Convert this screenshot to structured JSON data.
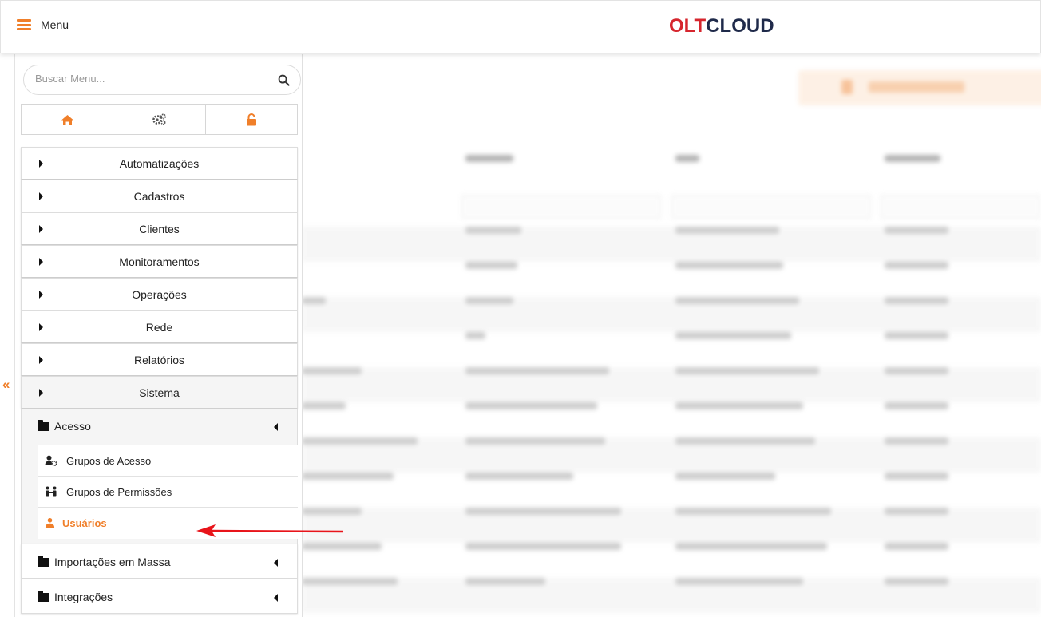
{
  "topbar": {
    "menu_label": "Menu",
    "logo_part1": "OLT",
    "logo_part2": "CLOUD"
  },
  "sidebar": {
    "search": {
      "placeholder": "Buscar Menu...",
      "value": ""
    },
    "quick_buttons": [
      {
        "icon": "home-icon"
      },
      {
        "icon": "gears-icon"
      },
      {
        "icon": "unlock-icon"
      }
    ],
    "items": [
      {
        "label": "Automatizações"
      },
      {
        "label": "Cadastros"
      },
      {
        "label": "Clientes"
      },
      {
        "label": "Monitoramentos"
      },
      {
        "label": "Operações"
      },
      {
        "label": "Rede"
      },
      {
        "label": "Relatórios"
      },
      {
        "label": "Sistema"
      }
    ],
    "sistema_sub": {
      "acesso": {
        "label": "Acesso",
        "children": [
          {
            "label": "Grupos de Acesso",
            "icon": "user-settings-icon"
          },
          {
            "label": "Grupos de Permissões",
            "icon": "users-permissions-icon"
          },
          {
            "label": "Usuários",
            "icon": "user-icon",
            "active": true
          }
        ]
      },
      "importacoes": {
        "label": "Importações em Massa"
      },
      "integracoes": {
        "label": "Integrações"
      }
    }
  },
  "colors": {
    "accent": "#f07f2a",
    "logo_red": "#d6262e",
    "logo_navy": "#1f2a4a",
    "annotation_arrow": "#e8141a"
  }
}
